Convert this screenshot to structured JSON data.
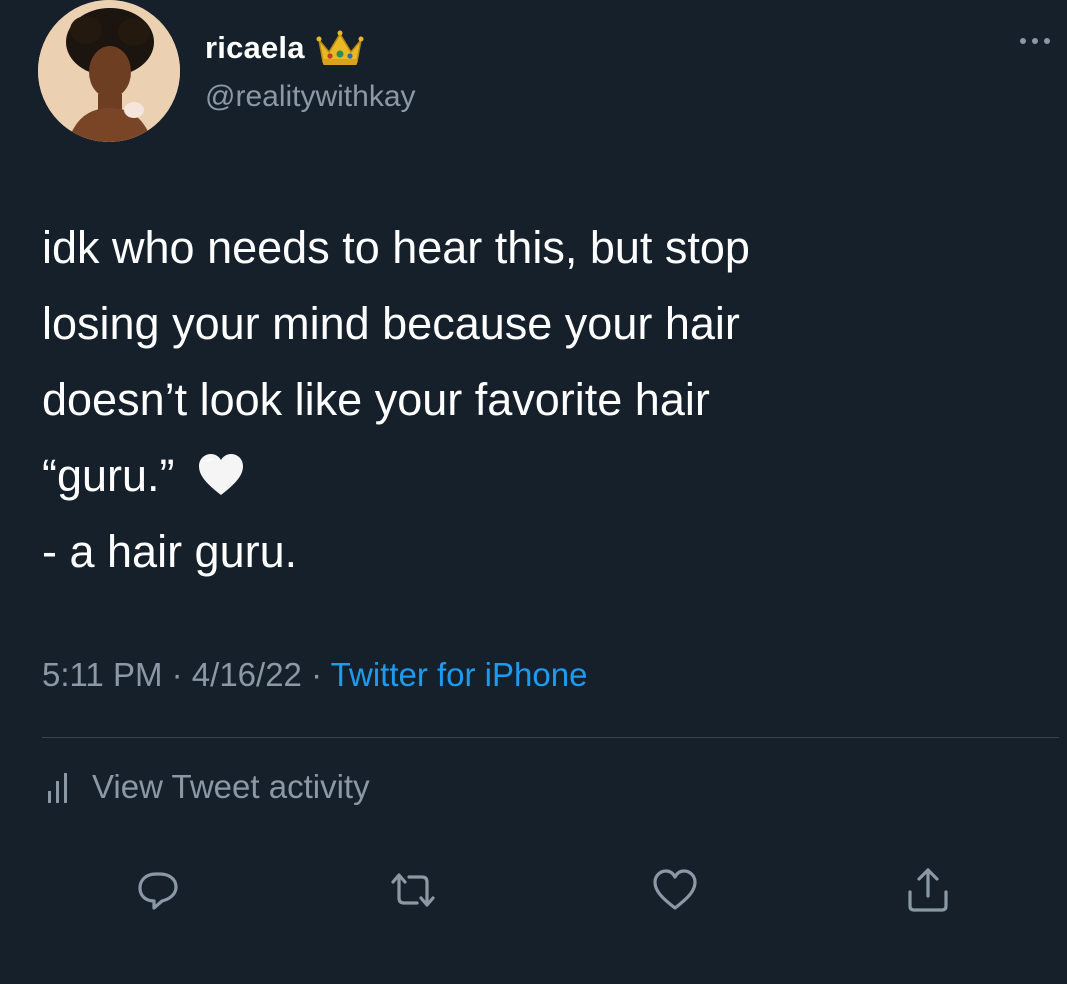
{
  "tweet": {
    "author": {
      "display_name": "ricaela",
      "handle": "@realitywithkay",
      "avatar": "profile-photo",
      "badge_icon": "crown-icon"
    },
    "text_lines": [
      "idk who needs to hear this, but stop",
      "losing your mind because your hair",
      "doesn’t look like your favorite hair",
      "“guru.”",
      "- a hair guru."
    ],
    "emoji": "white-heart-icon",
    "time": "5:11 PM",
    "date": "4/16/22",
    "separator": "·",
    "source": "Twitter for iPhone"
  },
  "activity": {
    "label": "View Tweet activity",
    "icon": "analytics-icon"
  },
  "actions": {
    "reply_icon": "reply-icon",
    "retweet_icon": "retweet-icon",
    "like_icon": "like-heart-icon",
    "share_icon": "share-icon"
  },
  "colors": {
    "background": "#15202b",
    "primary_text": "#ffffff",
    "secondary_text": "#8b98a5",
    "link": "#1d9bf0",
    "divider": "#38444d"
  }
}
